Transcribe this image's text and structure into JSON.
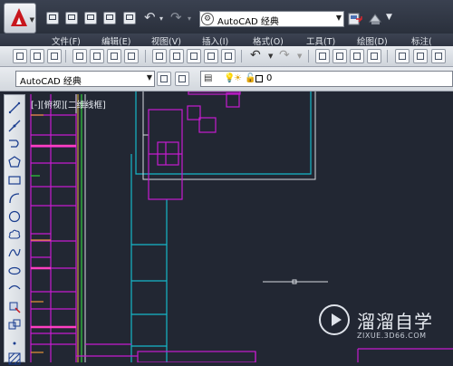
{
  "window": {
    "workspace_value": "AutoCAD 经典"
  },
  "menu": {
    "items": [
      "文件(F)",
      "编辑(E)",
      "视图(V)",
      "插入(I)",
      "格式(O)",
      "工具(T)",
      "绘图(D)",
      "标注("
    ]
  },
  "toolbar": {
    "workspace_value": "AutoCAD 经典",
    "layer_value": "0"
  },
  "viewport": {
    "label": "[-][俯视][二维线框]"
  },
  "watermark": {
    "text": "溜溜自学",
    "url": "ZIXUE.3D66.COM"
  },
  "colors": {
    "canvas_bg": "#222733",
    "magenta": "#c61bd0",
    "cyan": "#16b7c9",
    "white": "#d8dbe0",
    "green": "#2ecc3b",
    "orange": "#e8943a",
    "pink": "#ff3fc2"
  }
}
